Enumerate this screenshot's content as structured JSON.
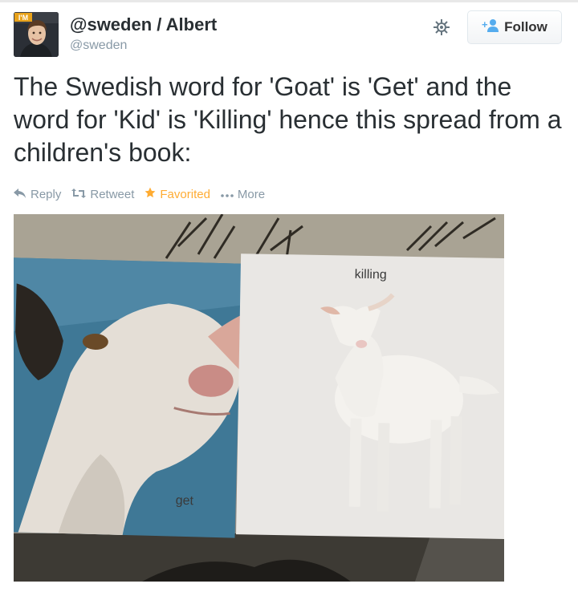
{
  "user": {
    "display_name": "@sweden / Albert",
    "screen_name": "@sweden",
    "avatar_badge": "I'M"
  },
  "header": {
    "follow_label": "Follow"
  },
  "tweet": {
    "text": "The Swedish word for 'Goat' is 'Get' and the word for 'Kid' is 'Killing' hence this spread from a children's book:"
  },
  "actions": {
    "reply": "Reply",
    "retweet": "Retweet",
    "favorite": "Favorited",
    "more": "More"
  },
  "photo": {
    "left_page_caption": "get",
    "right_page_caption": "killing"
  },
  "colors": {
    "favorite": "#ffac33",
    "muted": "#8899a6",
    "follow_icon": "#55acee",
    "badge": "#e8a21a"
  },
  "icons": [
    "gear-icon",
    "follow-user-icon",
    "reply-icon",
    "retweet-icon",
    "star-icon",
    "more-icon"
  ]
}
